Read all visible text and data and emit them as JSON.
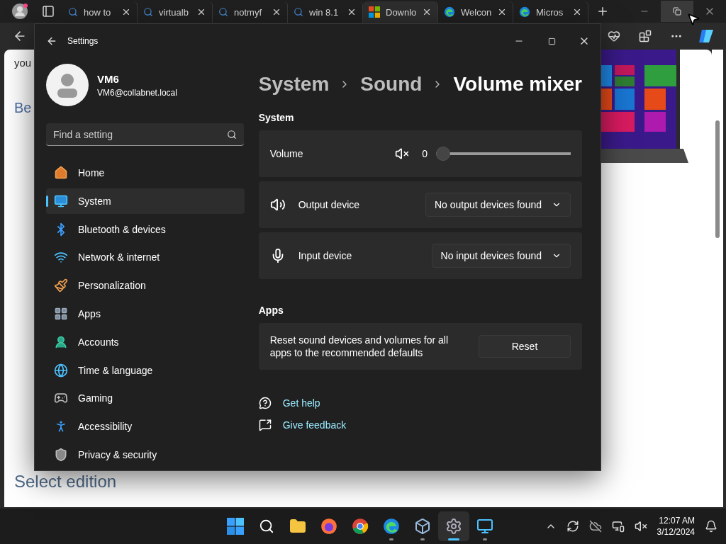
{
  "browser": {
    "tabs": [
      {
        "label": "how to",
        "kind": "search",
        "selected": false
      },
      {
        "label": "virtualb",
        "kind": "search",
        "selected": false
      },
      {
        "label": "notmyf",
        "kind": "search",
        "selected": false
      },
      {
        "label": "win 8.1",
        "kind": "search",
        "selected": false
      },
      {
        "label": "Downlo",
        "kind": "windows",
        "selected": true
      },
      {
        "label": "Welcon",
        "kind": "edge",
        "selected": false
      },
      {
        "label": "Micros",
        "kind": "edge",
        "selected": false
      }
    ],
    "page": {
      "lines": [
        "you",
        "Be"
      ],
      "heading": "Select edition"
    }
  },
  "settings": {
    "title": "Settings",
    "user": {
      "name": "VM6",
      "email": "VM6@collabnet.local"
    },
    "search": {
      "placeholder": "Find a setting"
    },
    "nav": [
      {
        "label": "Home",
        "kind": "home",
        "selected": false
      },
      {
        "label": "System",
        "kind": "system",
        "selected": true
      },
      {
        "label": "Bluetooth & devices",
        "kind": "bluetooth",
        "selected": false
      },
      {
        "label": "Network & internet",
        "kind": "network",
        "selected": false
      },
      {
        "label": "Personalization",
        "kind": "brush",
        "selected": false
      },
      {
        "label": "Apps",
        "kind": "apps",
        "selected": false
      },
      {
        "label": "Accounts",
        "kind": "accounts",
        "selected": false
      },
      {
        "label": "Time & language",
        "kind": "time",
        "selected": false
      },
      {
        "label": "Gaming",
        "kind": "gaming",
        "selected": false
      },
      {
        "label": "Accessibility",
        "kind": "accessibility",
        "selected": false
      },
      {
        "label": "Privacy & security",
        "kind": "privacy",
        "selected": false
      }
    ],
    "breadcrumb": [
      "System",
      "Sound",
      "Volume mixer"
    ],
    "system_section": {
      "title": "System",
      "rows": [
        {
          "kind": "volume",
          "label": "Volume",
          "muted": true,
          "reading": "0",
          "level": 0
        },
        {
          "kind": "output",
          "label": "Output device",
          "value": "No output devices found"
        },
        {
          "kind": "input",
          "label": "Input device",
          "value": "No input devices found"
        }
      ]
    },
    "apps_section": {
      "title": "Apps",
      "text": "Reset sound devices and volumes for all apps to the recommended defaults",
      "button": "Reset"
    },
    "links": [
      {
        "kind": "help",
        "label": "Get help"
      },
      {
        "kind": "feedback",
        "label": "Give feedback"
      }
    ]
  },
  "taskbar": {
    "apps": [
      {
        "kind": "start",
        "running": false,
        "selected": false
      },
      {
        "kind": "search",
        "running": false,
        "selected": false
      },
      {
        "kind": "explorer",
        "running": false,
        "selected": false
      },
      {
        "kind": "firefox",
        "running": false,
        "selected": false
      },
      {
        "kind": "chrome",
        "running": false,
        "selected": false
      },
      {
        "kind": "edge",
        "running": true,
        "selected": false
      },
      {
        "kind": "virtualbox",
        "running": true,
        "selected": false
      },
      {
        "kind": "settings",
        "running": true,
        "selected": true
      },
      {
        "kind": "remote",
        "running": true,
        "selected": false
      }
    ],
    "time": "12:07 AM",
    "date": "3/12/2024"
  }
}
